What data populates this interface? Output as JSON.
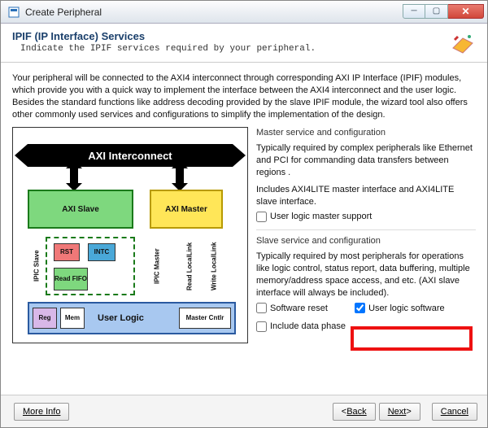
{
  "window": {
    "title": "Create Peripheral"
  },
  "header": {
    "title": "IPIF (IP Interface) Services",
    "subtitle": "Indicate the IPIF services required by your peripheral."
  },
  "intro": "Your peripheral will be connected to the AXI4 interconnect through corresponding AXI IP Interface (IPIF) modules, which provide you with a quick way to implement the interface between the AXI4 interconnect and the user logic. Besides the standard functions like address decoding provided by the slave IPIF module, the wizard tool also offers other commonly used services and configurations to simplify the implementation of the design.",
  "diagram": {
    "interconnect": "AXI Interconnect",
    "axi_slave": "AXI Slave",
    "axi_master": "AXI Master",
    "ipic_slave": "IPIC Slave",
    "ipic_master": "IPIC Master",
    "read_locallink": "Read LocalLink",
    "write_locallink": "Write LocalLink",
    "rst": "RST",
    "intc": "INTC",
    "read_fifo": "Read FIFO",
    "reg": "Reg",
    "mem": "Mem",
    "user_logic": "User Logic",
    "master_cntlr": "Master Cntlr"
  },
  "master": {
    "heading": "Master service and configuration",
    "p1": "Typically required by complex peripherals like Ethernet and PCI for commanding data transfers between regions .",
    "p2": "Includes AXI4LITE master interface and AXI4LITE slave interface.",
    "chk1": "User logic master support"
  },
  "slave": {
    "heading": "Slave service and configuration",
    "p1": "Typically required by most peripherals for operations like logic control, status report, data buffering, multiple memory/address space access, and etc. (AXI slave interface will always be included).",
    "chk_sw_reset": "Software reset",
    "chk_user_logic_sw": "User logic software",
    "chk_include_data": "Include data phase"
  },
  "footer": {
    "more_info": "More Info",
    "back": "Back",
    "next": "Next",
    "cancel": "Cancel"
  }
}
